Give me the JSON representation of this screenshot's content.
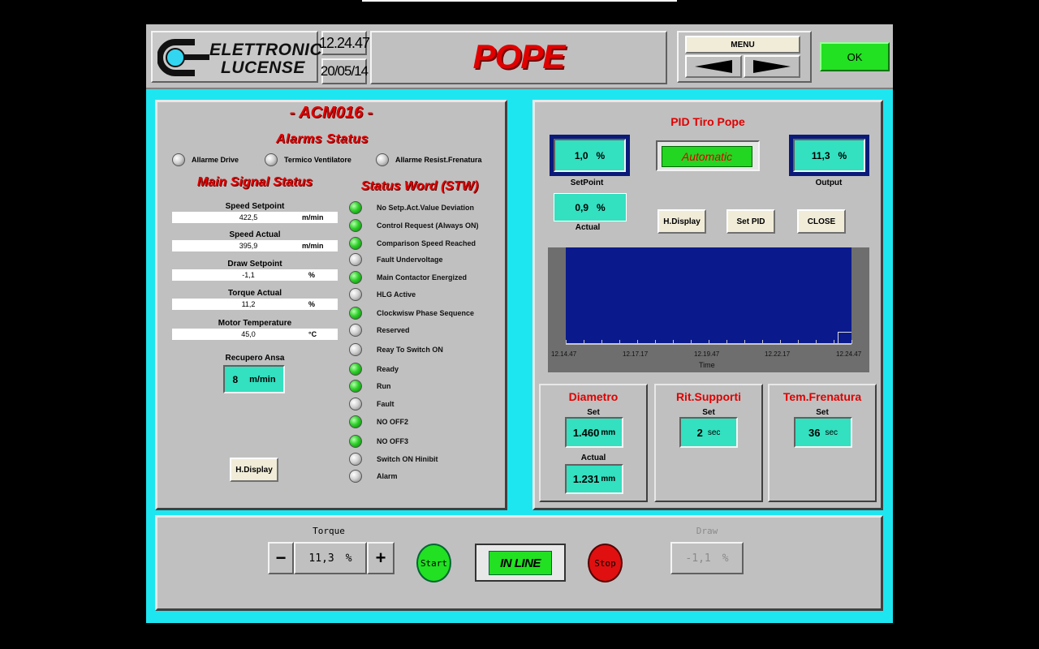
{
  "header": {
    "logo_line1": "ELETTRONICA",
    "logo_line2": "LUCENSE",
    "time": "12.24.47",
    "date": "20/05/14",
    "title": "POPE",
    "menu_label": "MENU",
    "ok_label": "OK"
  },
  "left": {
    "title": "- ACM016 -",
    "alarms_title": "Alarms Status",
    "alarms": [
      {
        "label": "Allarme Drive",
        "state": "off"
      },
      {
        "label": "Termico Ventilatore",
        "state": "off"
      },
      {
        "label": "Allarme Resist.Frenatura",
        "state": "off"
      }
    ],
    "main_title": "Main Signal Status",
    "signals": [
      {
        "label": "Speed Setpoint",
        "value": "422,5",
        "unit": "m/min"
      },
      {
        "label": "Speed Actual",
        "value": "395,9",
        "unit": "m/min"
      },
      {
        "label": "Draw Setpoint",
        "value": "-1,1",
        "unit": "%"
      },
      {
        "label": "Torque Actual",
        "value": "11,2",
        "unit": "%"
      },
      {
        "label": "Motor Temperature",
        "value": "45,0",
        "unit": "°C"
      }
    ],
    "recupero_label": "Recupero Ansa",
    "recupero_value": "8",
    "recupero_unit": "m/min",
    "hdisplay_label": "H.Display",
    "stw_title": "Status Word (STW)",
    "stw": [
      {
        "label": "No Setp.Act.Value Deviation",
        "state": "on"
      },
      {
        "label": "Control Request (Always ON)",
        "state": "on"
      },
      {
        "label": "Comparison Speed Reached",
        "state": "on"
      },
      {
        "label": "Fault Undervoltage",
        "state": "off"
      },
      {
        "label": "Main Contactor Energized",
        "state": "on"
      },
      {
        "label": "HLG Active",
        "state": "off"
      },
      {
        "label": "Clockwisw Phase Sequence",
        "state": "on"
      },
      {
        "label": "Reserved",
        "state": "off"
      },
      {
        "label": "Reay To Switch ON",
        "state": "off"
      },
      {
        "label": "Ready",
        "state": "on"
      },
      {
        "label": "Run",
        "state": "on"
      },
      {
        "label": "Fault",
        "state": "off"
      },
      {
        "label": "NO OFF2",
        "state": "on"
      },
      {
        "label": "NO OFF3",
        "state": "on"
      },
      {
        "label": "Switch ON Hinibit",
        "state": "off"
      },
      {
        "label": "Alarm",
        "state": "off"
      }
    ]
  },
  "pid": {
    "title": "PID Tiro Pope",
    "setpoint_value": "1,0",
    "setpoint_unit": "%",
    "setpoint_label": "SetPoint",
    "mode": "Automatic",
    "output_value": "11,3",
    "output_unit": "%",
    "output_label": "Output",
    "actual_value": "0,9",
    "actual_unit": "%",
    "actual_label": "Actual",
    "hdisplay_label": "H.Display",
    "setpid_label": "Set PID",
    "close_label": "CLOSE",
    "chart_xlabel": "Time",
    "chart_ticks": [
      "12.14.47",
      "12.17.17",
      "12.19.47",
      "12.22.17",
      "12.24.47"
    ]
  },
  "diametro": {
    "title": "Diametro",
    "set_label": "Set",
    "set_value": "1.460",
    "set_unit": "mm",
    "actual_label": "Actual",
    "actual_value": "1.231",
    "actual_unit": "mm"
  },
  "supporti": {
    "title": "Rit.Supporti",
    "set_label": "Set",
    "set_value": "2",
    "set_unit": "sec"
  },
  "frenatura": {
    "title": "Tem.Frenatura",
    "set_label": "Set",
    "set_value": "36",
    "set_unit": "sec"
  },
  "bottom": {
    "torque_label": "Torque",
    "torque_value": "11,3",
    "torque_unit": "%",
    "minus_label": "−",
    "plus_label": "+",
    "start_label": "Start",
    "status": "IN LINE",
    "stop_label": "Stop",
    "draw_label": "Draw",
    "draw_value": "-1,1",
    "draw_unit": "%"
  },
  "colors": {
    "background": "#1ee6f0",
    "panel": "#c0c0c0",
    "teal": "#33e0c0",
    "title_red": "#e00000",
    "led_green": "#2ed12a",
    "chart_bg": "#0a1a8c"
  }
}
